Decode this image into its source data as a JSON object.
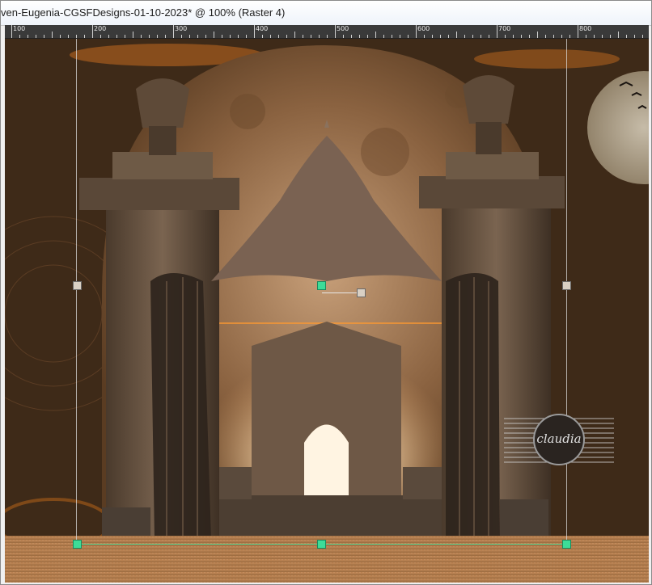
{
  "window": {
    "title": "ven-Eugenia-CGSFDesigns-01-10-2023* @ 100% (Raster 4)"
  },
  "ruler": {
    "labels": [
      "100",
      "200",
      "300",
      "400",
      "500",
      "600",
      "700",
      "800"
    ]
  },
  "watermark": {
    "text": "claudia"
  },
  "colors": {
    "canvas_bg": "#3a2816",
    "sepia": "#9c7450",
    "floor": "#b07a4a",
    "handle_green": "#3ddc98"
  }
}
